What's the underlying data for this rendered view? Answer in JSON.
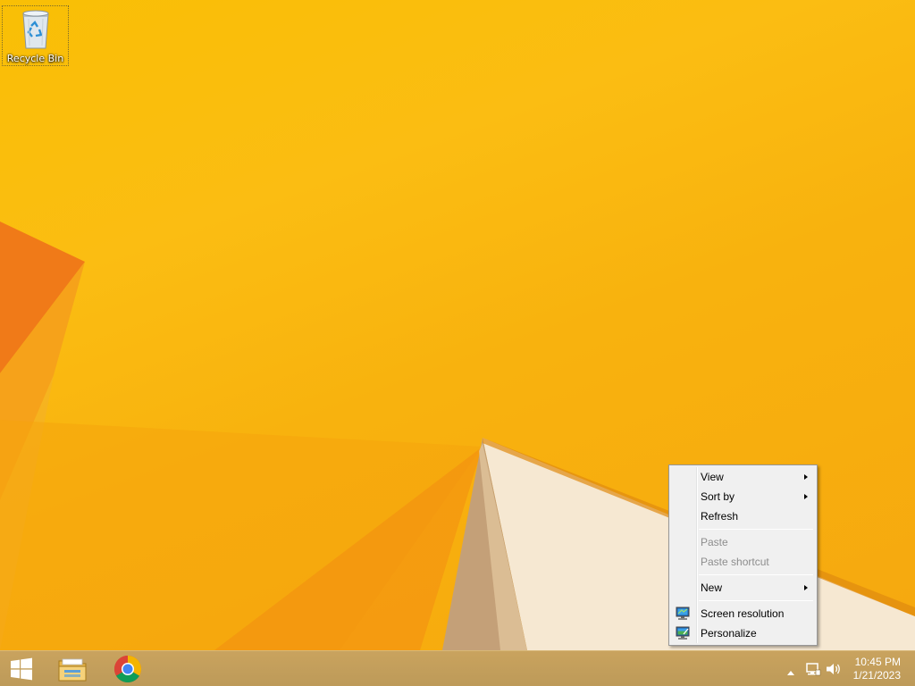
{
  "desktop": {
    "icons": [
      {
        "label": "Recycle Bin",
        "icon": "recycle-bin-icon"
      }
    ]
  },
  "context_menu": {
    "items": [
      {
        "label": "View",
        "submenu": true,
        "enabled": true
      },
      {
        "label": "Sort by",
        "submenu": true,
        "enabled": true
      },
      {
        "label": "Refresh",
        "submenu": false,
        "enabled": true
      },
      {
        "label": "Paste",
        "submenu": false,
        "enabled": false
      },
      {
        "label": "Paste shortcut",
        "submenu": false,
        "enabled": false
      },
      {
        "label": "New",
        "submenu": true,
        "enabled": true
      },
      {
        "label": "Screen resolution",
        "submenu": false,
        "enabled": true,
        "icon": "screen-resolution-icon"
      },
      {
        "label": "Personalize",
        "submenu": false,
        "enabled": true,
        "icon": "personalize-icon"
      }
    ]
  },
  "taskbar": {
    "pinned": [
      {
        "name": "start",
        "icon": "windows-logo-icon"
      },
      {
        "name": "file-explorer",
        "icon": "file-explorer-icon"
      },
      {
        "name": "chrome",
        "icon": "chrome-icon"
      }
    ],
    "tray": {
      "icons": [
        "show-hidden-icons-icon",
        "network-icon",
        "volume-icon"
      ],
      "time": "10:45 PM",
      "date": "1/21/2023"
    }
  },
  "colors": {
    "wallpaper_primary": "#f9bf05",
    "wallpaper_accent": "#f47d14",
    "taskbar": "#c4a05c",
    "menu_background": "#f0f0f0",
    "disabled_text": "#8d8d8d"
  }
}
